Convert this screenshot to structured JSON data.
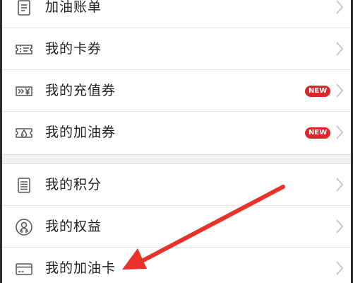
{
  "group_a": {
    "items": [
      {
        "label": "加油账单",
        "icon": "bill-list-icon"
      },
      {
        "label": "我的卡券",
        "icon": "ticket-icon"
      },
      {
        "label": "我的充值券",
        "icon": "recharge-coupon-icon",
        "badge": "NEW"
      },
      {
        "label": "我的加油券",
        "icon": "fuel-coupon-icon",
        "badge": "NEW"
      }
    ]
  },
  "group_b": {
    "items": [
      {
        "label": "我的积分",
        "icon": "points-document-icon"
      },
      {
        "label": "我的权益",
        "icon": "rights-badge-icon"
      },
      {
        "label": "我的加油卡",
        "icon": "fuel-card-icon"
      }
    ]
  },
  "colors": {
    "badge": "#e0242b",
    "arrow": "#e8332b",
    "icon": "#555555",
    "chevron": "#c8c8cc"
  }
}
